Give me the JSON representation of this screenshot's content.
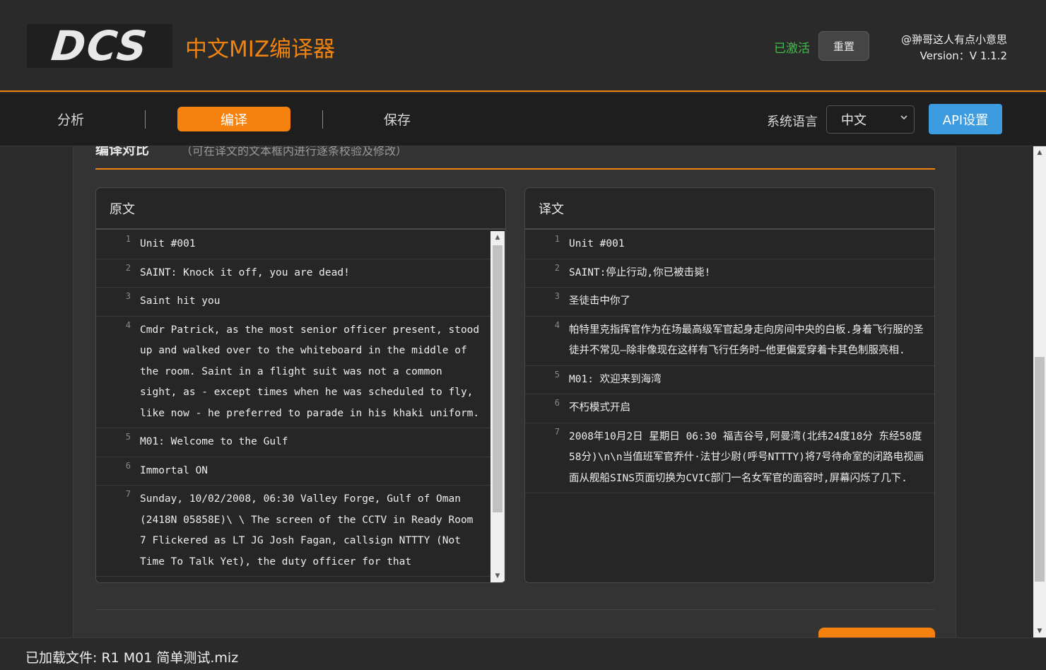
{
  "header": {
    "logo_text": "DCS",
    "app_title": "中文MIZ编译器",
    "activated_status": "已激活",
    "reset_label": "重置",
    "author": "@翀哥这人有点小意思",
    "version": "Version：V 1.1.2"
  },
  "nav": {
    "tabs": [
      {
        "label": "分析"
      },
      {
        "label": "编译"
      },
      {
        "label": "保存"
      }
    ],
    "lang_label": "系统语言",
    "lang_value": "中文",
    "api_label": "API设置"
  },
  "section": {
    "title": "编译对比",
    "hint": "（可在译文的文本框内进行逐条校验及修改）"
  },
  "source_panel": {
    "title": "原文",
    "rows": [
      {
        "num": "1",
        "text": "Unit #001"
      },
      {
        "num": "2",
        "text": "SAINT: Knock it off, you are dead!"
      },
      {
        "num": "3",
        "text": "Saint hit you"
      },
      {
        "num": "4",
        "text": "Cmdr Patrick, as the most senior officer present, stood up and walked over to the whiteboard in the middle of the room. Saint in a flight suit was not a common sight, as - except times when he was scheduled to fly, like now - he preferred to parade in his khaki uniform."
      },
      {
        "num": "5",
        "text": "M01: Welcome to the Gulf"
      },
      {
        "num": "6",
        "text": "Immortal ON"
      },
      {
        "num": "7",
        "text": "Sunday, 10/02/2008, 06:30 Valley Forge, Gulf of Oman (2418N 05858E)\\ \\ The screen of the CCTV in Ready Room 7 Flickered as LT JG Josh Fagan, callsign NTTTY (Not Time To Talk Yet), the duty officer for that"
      }
    ]
  },
  "target_panel": {
    "title": "译文",
    "rows": [
      {
        "num": "1",
        "text": "Unit #001"
      },
      {
        "num": "2",
        "text": "SAINT:停止行动,你已被击毙!"
      },
      {
        "num": "3",
        "text": "圣徒击中你了"
      },
      {
        "num": "4",
        "text": "帕特里克指挥官作为在场最高级军官起身走向房间中央的白板.身着飞行服的圣徒并不常见—除非像现在这样有飞行任务时—他更偏爱穿着卡其色制服亮相."
      },
      {
        "num": "5",
        "text": "M01: 欢迎来到海湾"
      },
      {
        "num": "6",
        "text": "不朽模式开启"
      },
      {
        "num": "7",
        "text": "2008年10月2日 星期日 06:30 福吉谷号,阿曼湾(北纬24度18分 东经58度58分)\\n\\n当值班军官乔什·法甘少尉(呼号NTTTY)将7号待命室的闭路电视画面从舰船SINS页面切换为CVIC部门一名女军官的面容时,屏幕闪烁了几下."
      }
    ]
  },
  "footer": {
    "loaded_file": "已加载文件: R1 M01 简单测试.miz"
  }
}
